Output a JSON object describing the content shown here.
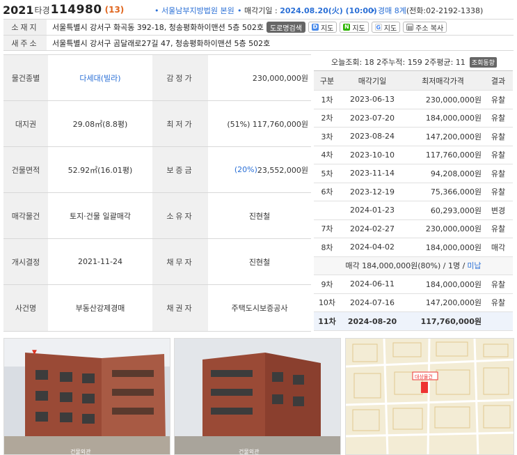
{
  "header": {
    "year": "2021",
    "case_type": "타경",
    "case_number": "114980",
    "count": "(13)",
    "court": "서울남부지방법원 본원",
    "sale_date_label": "매각기일 : ",
    "sale_date": "2024.08.20(火) (10:00)",
    "dept": "경매 8계",
    "phone": "(전화:02-2192-1338)"
  },
  "address": {
    "label1": "소재지",
    "value1": "서울특별시 강서구 화곡동 392-18, 청송평화하이맨션 5층 502호",
    "road_btn": "도로명검색",
    "map_d": "지도",
    "map_n": "지도",
    "map_g": "지도",
    "copy_btn": "주소 복사",
    "label2": "새주소",
    "value2": "서울특별시 강서구 곰달래로27길 47, 청송평화하이맨션 5층 502호"
  },
  "left_table": [
    {
      "l1": "물건종별",
      "v1": "다세대(빌라)",
      "l2": "감정가",
      "v2": "230,000,000원"
    },
    {
      "l1": "대지권",
      "v1": "29.08㎡(8.8평)",
      "l2": "최저가",
      "v2": "(51%) 117,760,000원"
    },
    {
      "l1": "건물면적",
      "v1": "52.92㎡(16.01평)",
      "l2": "보증금",
      "v2_pct": "(20%)",
      "v2": " 23,552,000원"
    },
    {
      "l1": "매각물건",
      "v1": "토지·건물 일괄매각",
      "l2": "소유자",
      "v2": "진현철"
    },
    {
      "l1": "개시결정",
      "v1": "2021-11-24",
      "l2": "채무자",
      "v2": "진현철"
    },
    {
      "l1": "사건명",
      "v1": "부동산강제경매",
      "l2": "채권자",
      "v2": "주택도시보증공사"
    }
  ],
  "stats": {
    "text": "오늘조회: 18  2주누적: 159  2주평균: 11",
    "btn": "조회동향"
  },
  "rounds_header": {
    "c1": "구분",
    "c2": "매각기일",
    "c3": "최저매각가격",
    "c4": "결과"
  },
  "rounds": [
    {
      "c1": "1차",
      "c2": "2023-06-13",
      "c3": "230,000,000원",
      "c4": "유찰"
    },
    {
      "c1": "2차",
      "c2": "2023-07-20",
      "c3": "184,000,000원",
      "c4": "유찰"
    },
    {
      "c1": "3차",
      "c2": "2023-08-24",
      "c3": "147,200,000원",
      "c4": "유찰"
    },
    {
      "c1": "4차",
      "c2": "2023-10-10",
      "c3": "117,760,000원",
      "c4": "유찰"
    },
    {
      "c1": "5차",
      "c2": "2023-11-14",
      "c3": "94,208,000원",
      "c4": "유찰"
    },
    {
      "c1": "6차",
      "c2": "2023-12-19",
      "c3": "75,366,000원",
      "c4": "유찰"
    },
    {
      "c1": "",
      "c2": "2024-01-23",
      "c3": "60,293,000원",
      "c4": "변경"
    },
    {
      "c1": "7차",
      "c2": "2024-02-27",
      "c3": "230,000,000원",
      "c4": "유찰"
    },
    {
      "c1": "8차",
      "c2": "2024-04-02",
      "c3": "184,000,000원",
      "c4": "매각"
    }
  ],
  "sale_note": "매각 184,000,000원(80%) / 1명 / ",
  "sale_note_link": "미납",
  "rounds2": [
    {
      "c1": "9차",
      "c2": "2024-06-11",
      "c3": "184,000,000원",
      "c4": "유찰"
    },
    {
      "c1": "10차",
      "c2": "2024-07-16",
      "c3": "147,200,000원",
      "c4": "유찰"
    },
    {
      "c1": "11차",
      "c2": "2024-08-20",
      "c3": "117,760,000원",
      "c4": ""
    }
  ],
  "photos": {
    "caption1": "건물외관",
    "caption2": "건물외관",
    "map_label": "대상물건"
  },
  "colors": {
    "accent": "#2a6fd6",
    "orange": "#e0651d",
    "label_bg": "#f0f0f0"
  }
}
